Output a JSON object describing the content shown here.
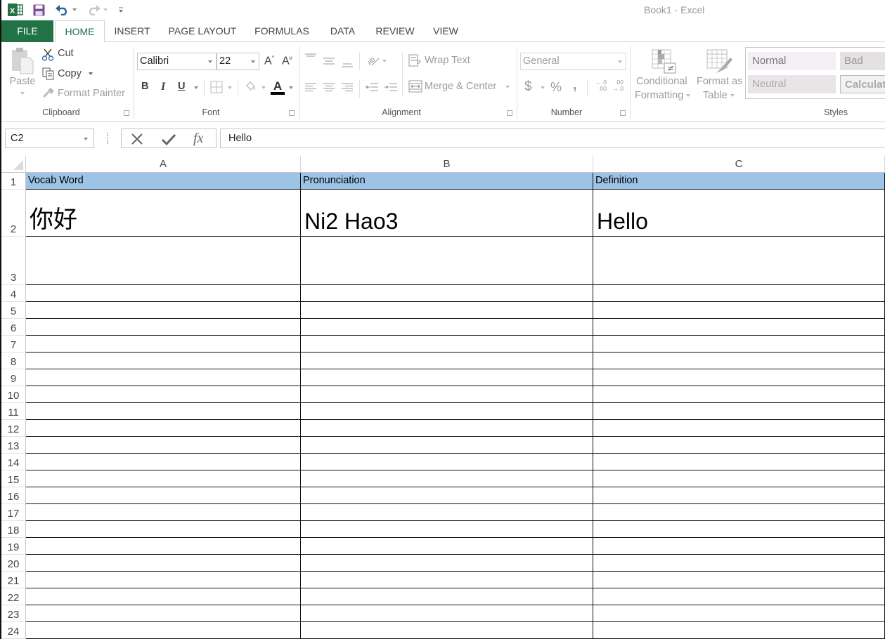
{
  "window": {
    "title": "Book1 - Excel"
  },
  "quick_access": [
    {
      "name": "excel-logo-icon",
      "glyph": "X"
    },
    {
      "name": "save-icon"
    },
    {
      "name": "undo-icon"
    },
    {
      "name": "redo-icon"
    },
    {
      "name": "customize-quick-access-icon"
    }
  ],
  "tabs": [
    {
      "label": "FILE"
    },
    {
      "label": "HOME",
      "active": true
    },
    {
      "label": "INSERT"
    },
    {
      "label": "PAGE LAYOUT"
    },
    {
      "label": "FORMULAS"
    },
    {
      "label": "DATA"
    },
    {
      "label": "REVIEW"
    },
    {
      "label": "VIEW"
    }
  ],
  "ribbon": {
    "clipboard": {
      "label": "Clipboard",
      "paste": "Paste",
      "cut": "Cut",
      "copy": "Copy",
      "format_painter": "Format Painter"
    },
    "font": {
      "label": "Font",
      "font_name": "Calibri",
      "font_size": "22",
      "bold": "B",
      "italic": "I",
      "underline": "U",
      "grow_font": "A",
      "shrink_font": "A",
      "font_color": "A"
    },
    "alignment": {
      "label": "Alignment",
      "wrap_text": "Wrap Text",
      "merge_center": "Merge & Center"
    },
    "number": {
      "label": "Number",
      "format": "General",
      "currency": "$",
      "percent": "%",
      "comma": ",",
      "inc_decimal_top": "←.0",
      "inc_decimal_bottom": ".00",
      "dec_decimal_top": ".00",
      "dec_decimal_bottom": "→.0"
    },
    "styles": {
      "label": "Styles",
      "conditional_formatting_line1": "Conditional",
      "conditional_formatting_line2": "Formatting",
      "format_as_table_line1": "Format as",
      "format_as_table_line2": "Table",
      "gallery": [
        "Normal",
        "Bad",
        "Neutral",
        "Calculat"
      ]
    }
  },
  "formula_bar": {
    "name_box": "C2",
    "cancel": "✕",
    "enter": "✔",
    "fx": "fx",
    "value": "Hello"
  },
  "sheet": {
    "columns": [
      "A",
      "B",
      "C"
    ],
    "rows": [
      "1",
      "2",
      "3",
      "4",
      "5",
      "6",
      "7",
      "8",
      "9",
      "10",
      "11",
      "12",
      "13",
      "14",
      "15",
      "16",
      "17",
      "18",
      "19",
      "20",
      "21",
      "22",
      "23",
      "24"
    ],
    "header_fill": "#9dc3e6",
    "cells": {
      "A1": "Vocab Word",
      "B1": "Pronunciation",
      "C1": "Definition",
      "A2": "你好",
      "B2": "Ni2 Hao3",
      "C2": "Hello"
    },
    "selected_cell": "C2"
  }
}
